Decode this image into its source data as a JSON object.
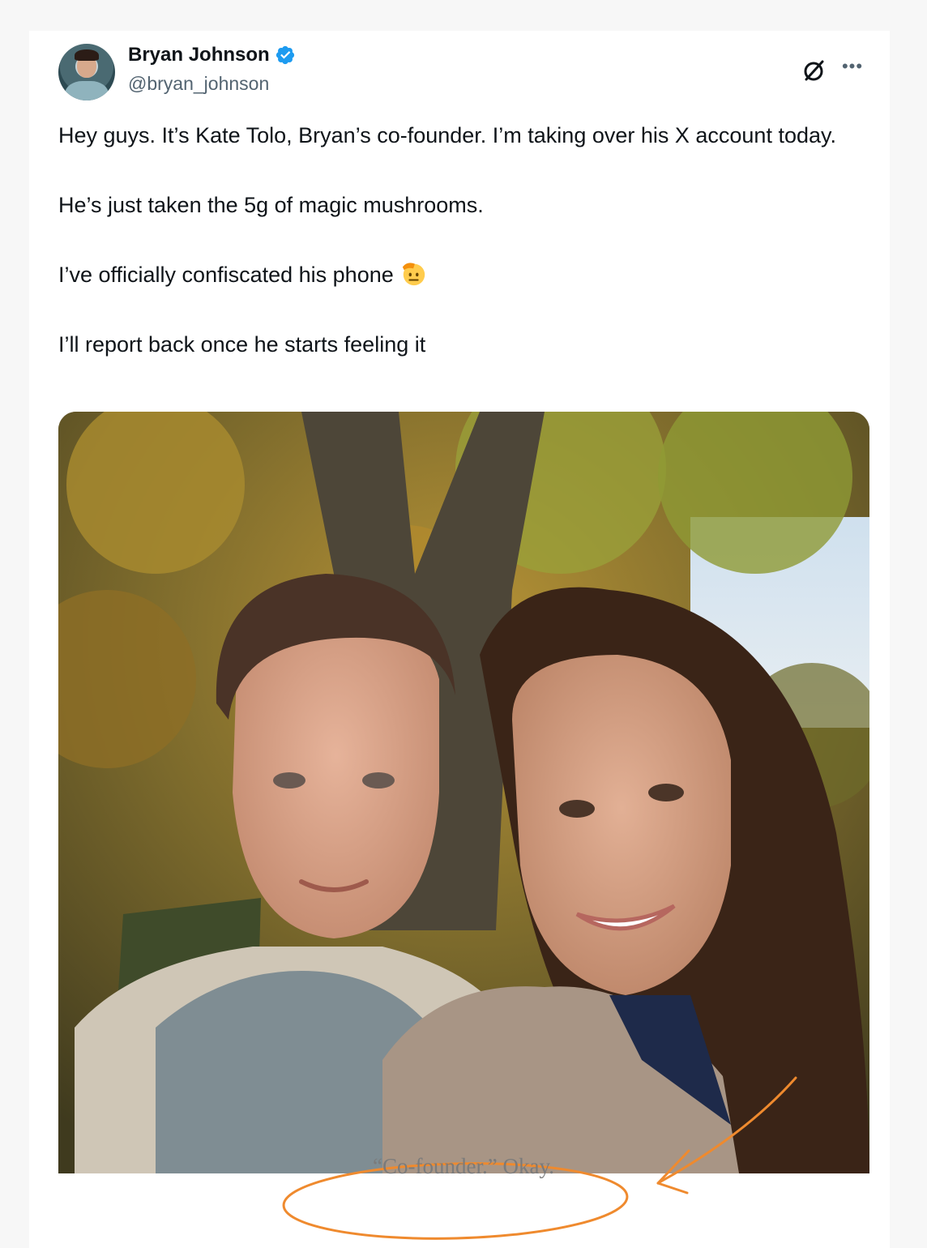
{
  "post": {
    "author_name": "Bryan Johnson",
    "author_handle": "@bryan_johnson",
    "lines": [
      "Hey guys. It’s Kate Tolo, Bryan’s co-founder. I’m taking over his X account today.",
      "He’s just taken the 5g of magic mushrooms.",
      "I’ve officially confiscated his phone",
      "I’ll report back once he starts feeling it"
    ]
  },
  "icons": {
    "verified": "verified-badge-icon",
    "grok": "grok-icon",
    "more": "more-icon",
    "salute": "saluting-face-emoji"
  },
  "caption": "“Co-founder.” Okay.",
  "colors": {
    "verified_blue": "#1d9bf0",
    "annotation_orange": "#ef8a2e",
    "caption_gray": "#7b7b7b"
  }
}
